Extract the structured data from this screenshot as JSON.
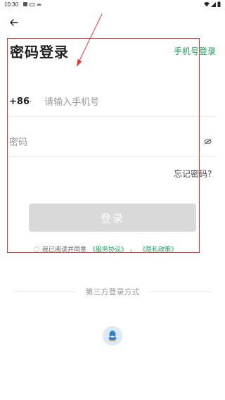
{
  "status_bar": {
    "time": "10:30"
  },
  "page": {
    "title": "密码登录",
    "phone_login_link": "手机号登录"
  },
  "phone": {
    "country_code": "+86",
    "separator": "·",
    "placeholder": "请输入手机号"
  },
  "password": {
    "placeholder": "密码"
  },
  "forgot_password": "忘记密码?",
  "login_button": "登录",
  "agreement": {
    "prefix": "我已阅读并同意",
    "service_link": "《服务协议》",
    "separator": "、",
    "privacy_link": "《隐私政策》"
  },
  "third_party": {
    "title": "第三方登录方式"
  },
  "colors": {
    "accent": "#19a35c",
    "button_disabled": "#d9d9d9",
    "annotation": "#e53935",
    "qq_bg": "#dbeaf9",
    "qq_icon": "#2f80d1"
  },
  "icons": {
    "back": "arrow-left-icon",
    "eye": "eye-off-icon",
    "qq": "qq-icon"
  }
}
